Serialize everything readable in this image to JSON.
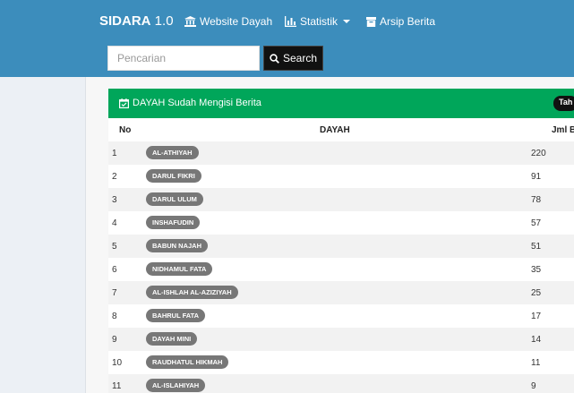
{
  "navbar": {
    "brand_bold": "SIDARA",
    "brand_version": " 1.0",
    "website_label": "Website Dayah",
    "statistik_label": "Statistik",
    "arsip_label": "Arsip Berita"
  },
  "search": {
    "placeholder": "Pencarian",
    "button_label": "Search"
  },
  "panel": {
    "title": "DAYAH Sudah Mengisi Berita",
    "year_badge": "Tah",
    "columns": {
      "no": "No",
      "dayah": "DAYAH",
      "jml": "Jml B"
    },
    "rows": [
      {
        "no": "1",
        "dayah": "AL-ATHIYAH",
        "jml": "220"
      },
      {
        "no": "2",
        "dayah": "DARUL FIKRI",
        "jml": "91"
      },
      {
        "no": "3",
        "dayah": "DARUL ULUM",
        "jml": "78"
      },
      {
        "no": "4",
        "dayah": "INSHAFUDIN",
        "jml": "57"
      },
      {
        "no": "5",
        "dayah": "BABUN NAJAH",
        "jml": "51"
      },
      {
        "no": "6",
        "dayah": "NIDHAMUL FATA",
        "jml": "35"
      },
      {
        "no": "7",
        "dayah": "AL-ISHLAH AL-AZIZIYAH",
        "jml": "25"
      },
      {
        "no": "8",
        "dayah": "BAHRUL FATA",
        "jml": "17"
      },
      {
        "no": "9",
        "dayah": "DAYAH MINI",
        "jml": "14"
      },
      {
        "no": "10",
        "dayah": "RAUDHATUL HIKMAH",
        "jml": "11"
      },
      {
        "no": "11",
        "dayah": "AL-ISLAHIYAH",
        "jml": "9"
      }
    ]
  },
  "colors": {
    "navbar": "#3c8dbc",
    "panel_header": "#00a65a",
    "badge": "#777777"
  }
}
